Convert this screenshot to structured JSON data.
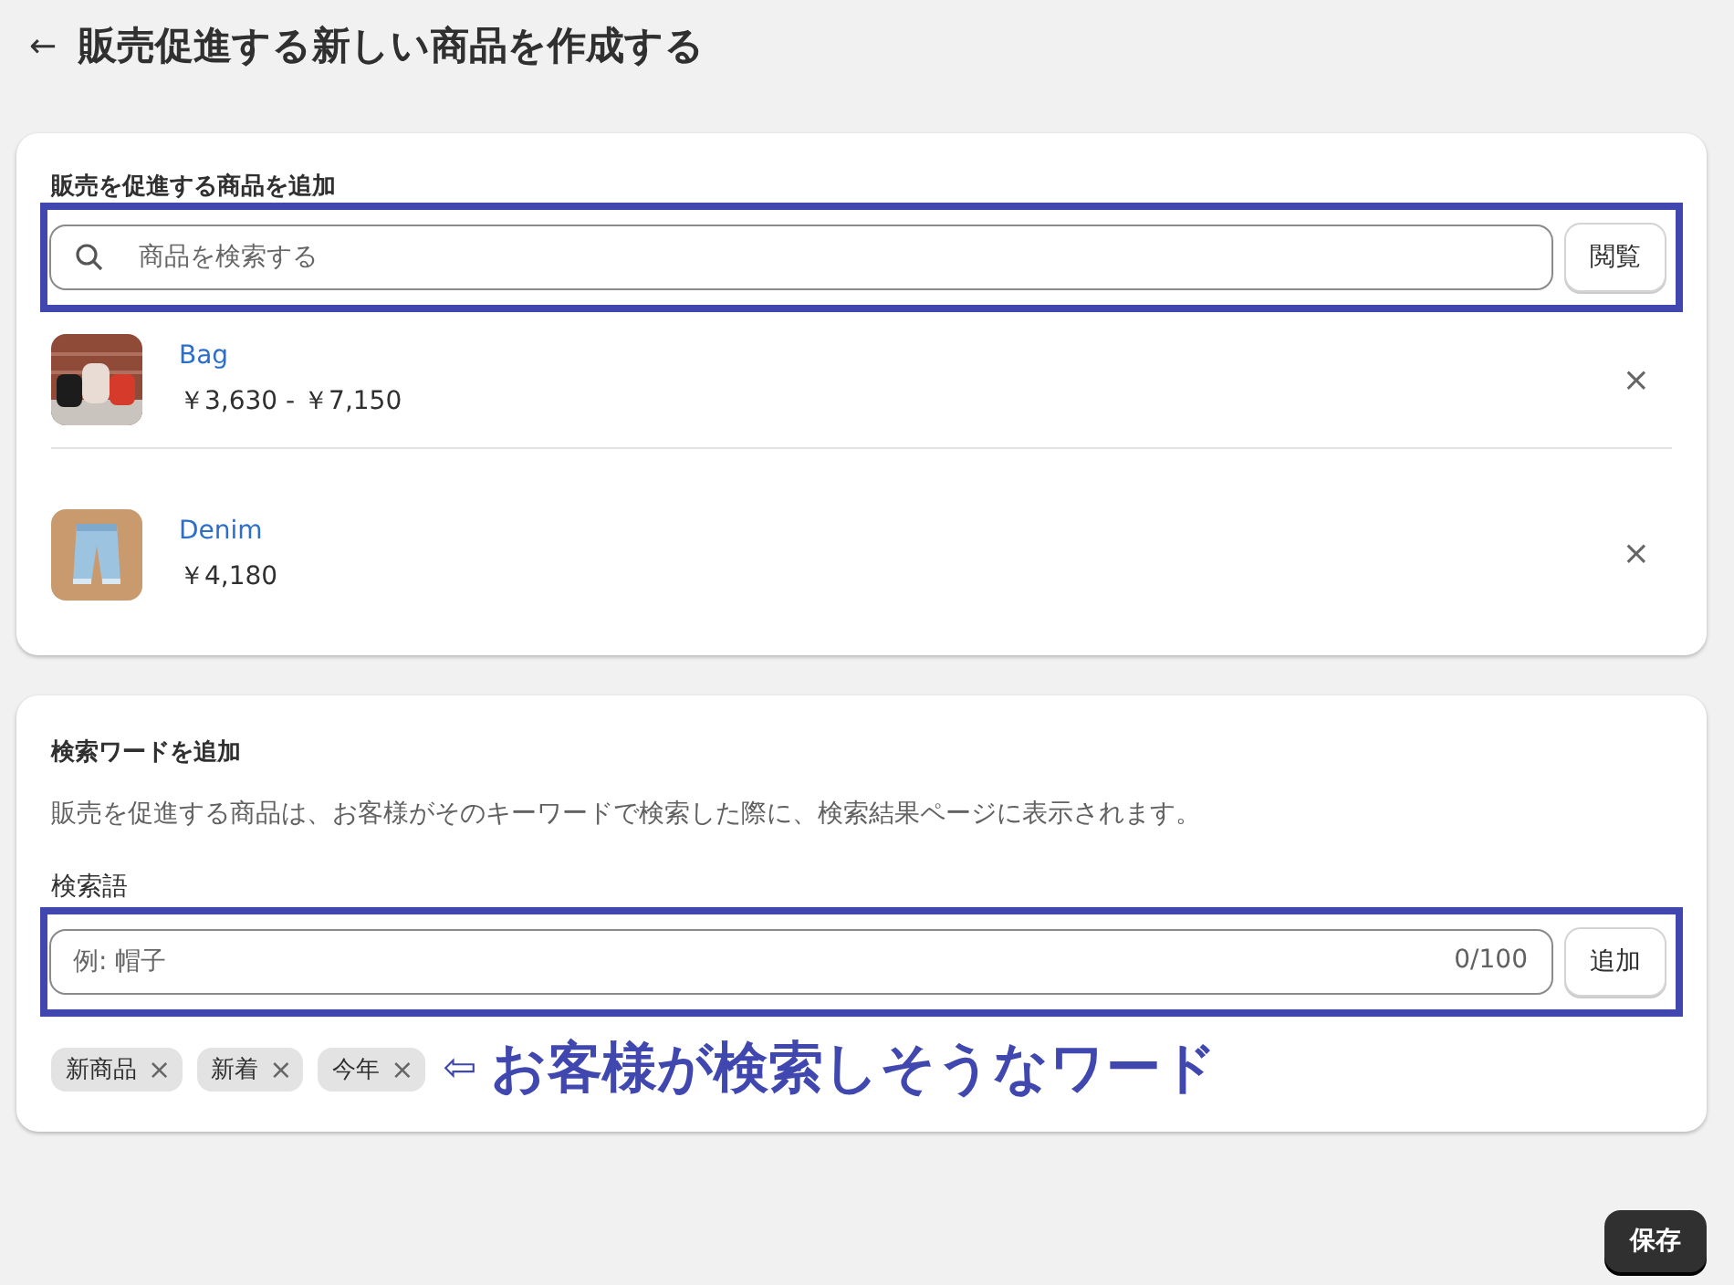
{
  "header": {
    "back": "←",
    "title": "販売促進する新しい商品を作成する"
  },
  "products_card": {
    "heading": "販売を促進する商品を追加",
    "search": {
      "placeholder": "商品を検索する"
    },
    "browse_button": "閲覧",
    "products": [
      {
        "name": "Bag",
        "price": "￥3,630 - ￥7,150",
        "remove": "×"
      },
      {
        "name": "Denim",
        "price": "￥4,180",
        "remove": "×"
      }
    ]
  },
  "keywords_card": {
    "heading": "検索ワードを追加",
    "description": "販売を促進する商品は、お客様がそのキーワードで検索した際に、検索結果ページに表示されます。",
    "field_label": "検索語",
    "field": {
      "placeholder": "例: 帽子",
      "counter": "0/100"
    },
    "add_button": "追加",
    "tags": [
      {
        "label": "新商品",
        "remove": "×"
      },
      {
        "label": "新着",
        "remove": "×"
      },
      {
        "label": "今年",
        "remove": "×"
      }
    ],
    "annotation": {
      "arrow": "⇦",
      "text": "お客様が検索しそうなワード"
    }
  },
  "save_button": "保存"
}
